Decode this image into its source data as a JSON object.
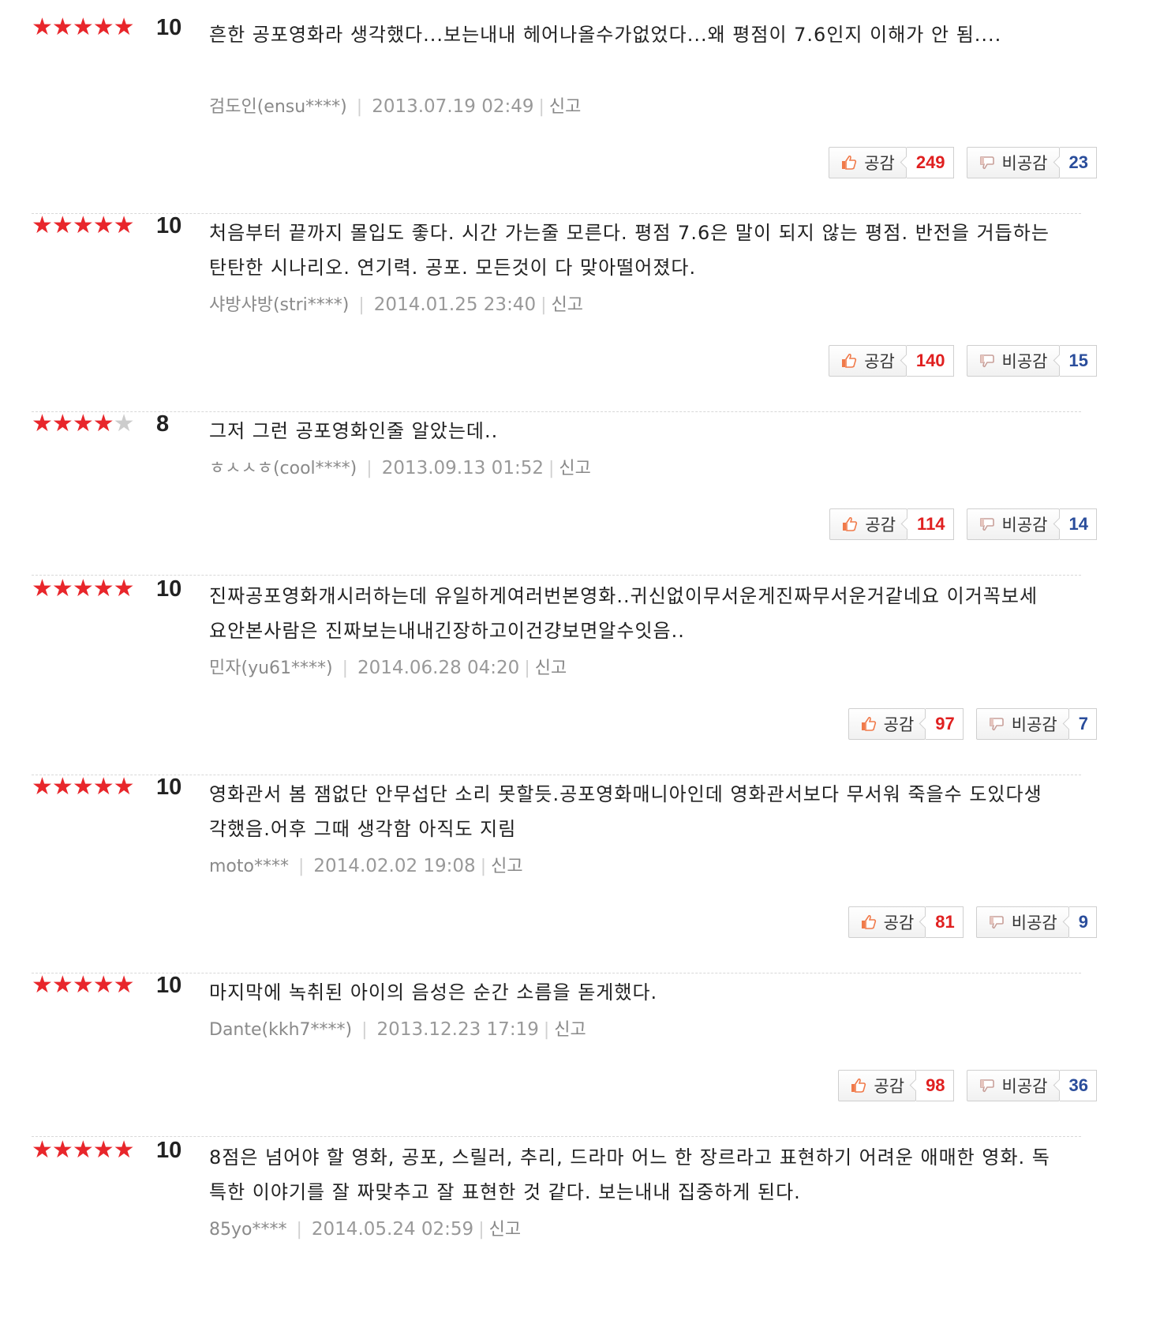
{
  "colors": {
    "star": "#e8262b",
    "star_off": "#cccccc",
    "sympathy_count": "#e02020",
    "nonsympathy_count": "#2a4d9b"
  },
  "labels": {
    "sympathy": "공감",
    "nonsympathy": "비공감",
    "report": "신고"
  },
  "reviews": [
    {
      "stars": 5,
      "score": "10",
      "text": "흔한 공포영화라 생각했다...보는내내 헤어나올수가없었다...왜 평점이 7.6인지 이해가 안 됨....",
      "author": "검도인(ensu****)",
      "date": "2013.07.19 02:49",
      "sympathy": "249",
      "nonsympathy": "23"
    },
    {
      "stars": 5,
      "score": "10",
      "text": "처음부터 끝까지 몰입도 좋다. 시간 가는줄 모른다. 평점 7.6은 말이 되지 않는 평점. 반전을 거듭하는 탄탄한 시나리오. 연기력. 공포. 모든것이 다 맞아떨어졌다.",
      "author": "샤방샤방(stri****)",
      "date": "2014.01.25 23:40",
      "sympathy": "140",
      "nonsympathy": "15"
    },
    {
      "stars": 4,
      "score": "8",
      "text": "그저 그런 공포영화인줄 알았는데..",
      "author": "ㅎㅅㅅㅎ(cool****)",
      "date": "2013.09.13 01:52",
      "sympathy": "114",
      "nonsympathy": "14"
    },
    {
      "stars": 5,
      "score": "10",
      "text": "진짜공포영화개시러하는데 유일하게여러번본영화..귀신없이무서운게진짜무서운거같네요 이거꼭보세요안본사람은 진짜보는내내긴장하고이건걍보면알수잇음..",
      "author": "민자(yu61****)",
      "date": "2014.06.28 04:20",
      "sympathy": "97",
      "nonsympathy": "7"
    },
    {
      "stars": 5,
      "score": "10",
      "text": "영화관서 봄 잼없단 안무섭단 소리 못할듯.공포영화매니아인데 영화관서보다 무서워 죽을수 도있다생각했음.어후 그때 생각함 아직도 지림",
      "author": "moto****",
      "date": "2014.02.02 19:08",
      "sympathy": "81",
      "nonsympathy": "9"
    },
    {
      "stars": 5,
      "score": "10",
      "text": "마지막에 녹취된 아이의 음성은 순간 소름을 돋게했다.",
      "author": "Dante(kkh7****)",
      "date": "2013.12.23 17:19",
      "sympathy": "98",
      "nonsympathy": "36"
    },
    {
      "stars": 5,
      "score": "10",
      "text": "8점은 넘어야 할 영화, 공포, 스릴러, 추리, 드라마 어느 한 장르라고 표현하기 어려운 애매한 영화. 독특한 이야기를 잘 짜맞추고 잘 표현한 것 같다. 보는내내 집중하게 된다.",
      "author": "85yo****",
      "date": "2014.05.24 02:59"
    }
  ]
}
